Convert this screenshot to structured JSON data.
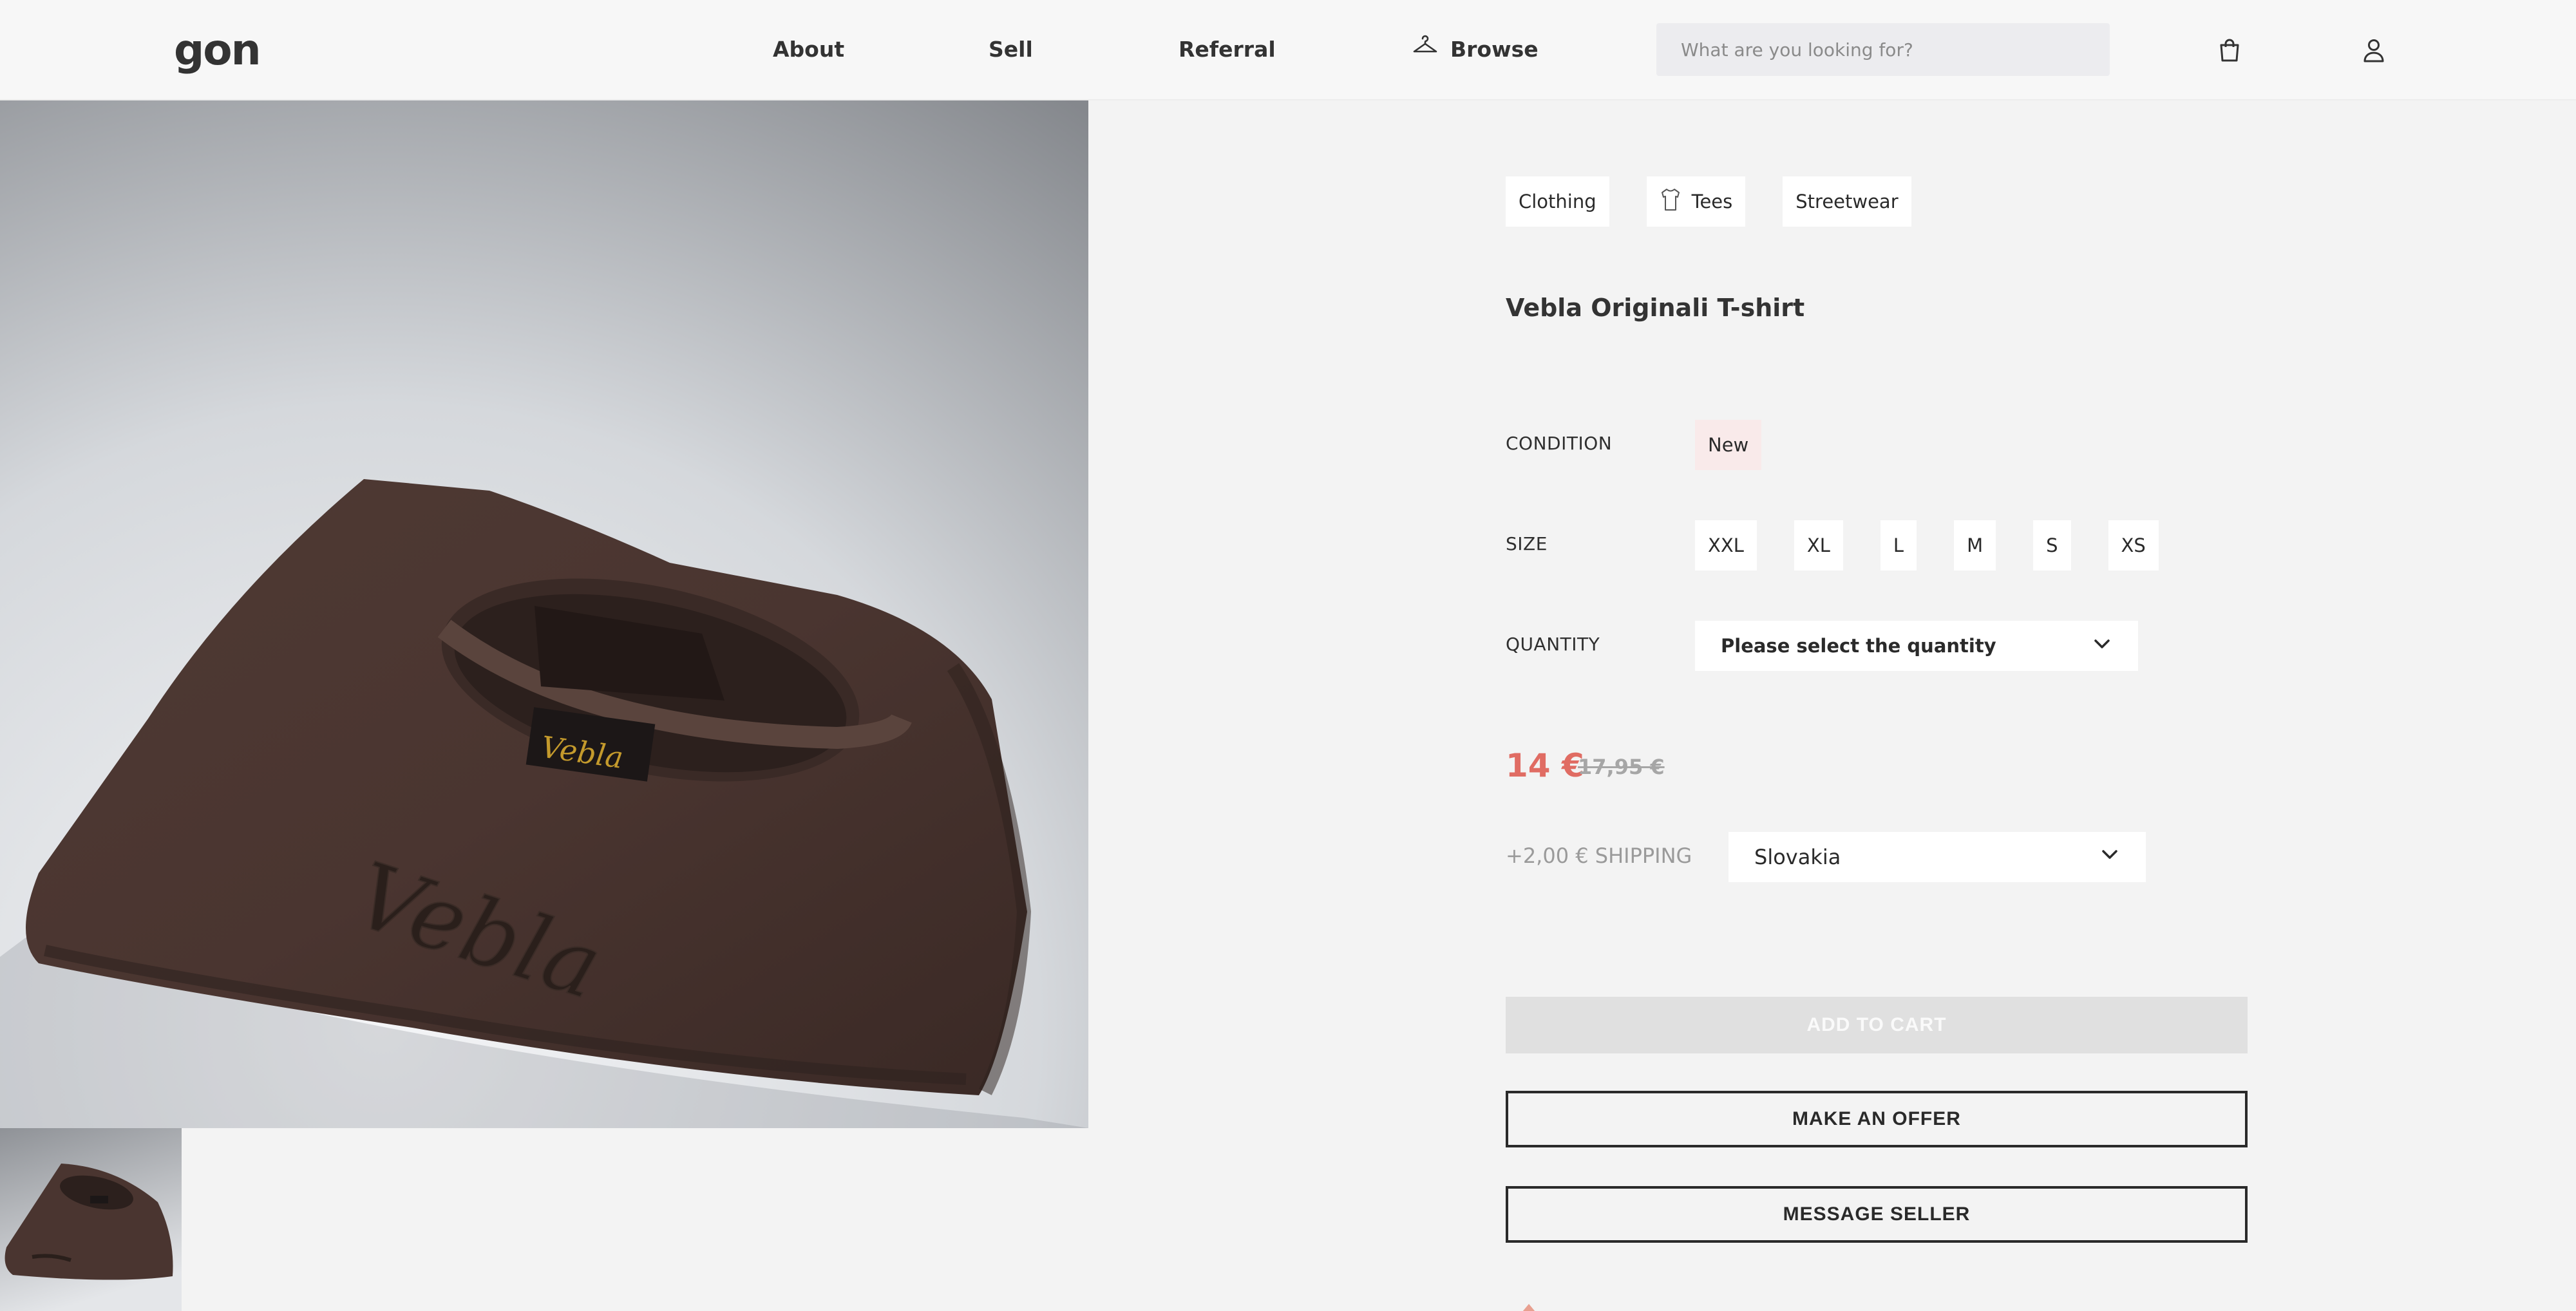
{
  "header": {
    "logo": "gon",
    "nav": {
      "about": "About",
      "sell": "Sell",
      "referral": "Referral",
      "browse": "Browse"
    },
    "search_placeholder": "What are you looking for?",
    "icons": [
      "hanger-icon",
      "shopping-bag-icon",
      "user-icon"
    ]
  },
  "gallery": {
    "embroidered_text": "Vebla",
    "label_text": "Vebla"
  },
  "product": {
    "tags": [
      "Clothing",
      "Tees",
      "Streetwear"
    ],
    "title": "Vebla Originali T-shirt",
    "condition_label": "CONDITION",
    "condition_value": "New",
    "size_label": "SIZE",
    "sizes": [
      "XXL",
      "XL",
      "L",
      "M",
      "S",
      "XS"
    ],
    "quantity_label": "QUANTITY",
    "quantity_placeholder": "Please select the quantity",
    "price": "14 €",
    "old_price": "17,95 €",
    "shipping_label": "+2,00 € SHIPPING",
    "shipping_country": "Slovakia"
  },
  "actions": {
    "add_to_cart": "ADD TO CART",
    "make_offer": "MAKE AN OFFER",
    "message_seller": "MESSAGE SELLER"
  },
  "colors": {
    "price_accent": "#e06c63",
    "condition_bg": "#f9eaea",
    "page_bg": "#f3f3f3",
    "shirt": "#4a3530"
  }
}
